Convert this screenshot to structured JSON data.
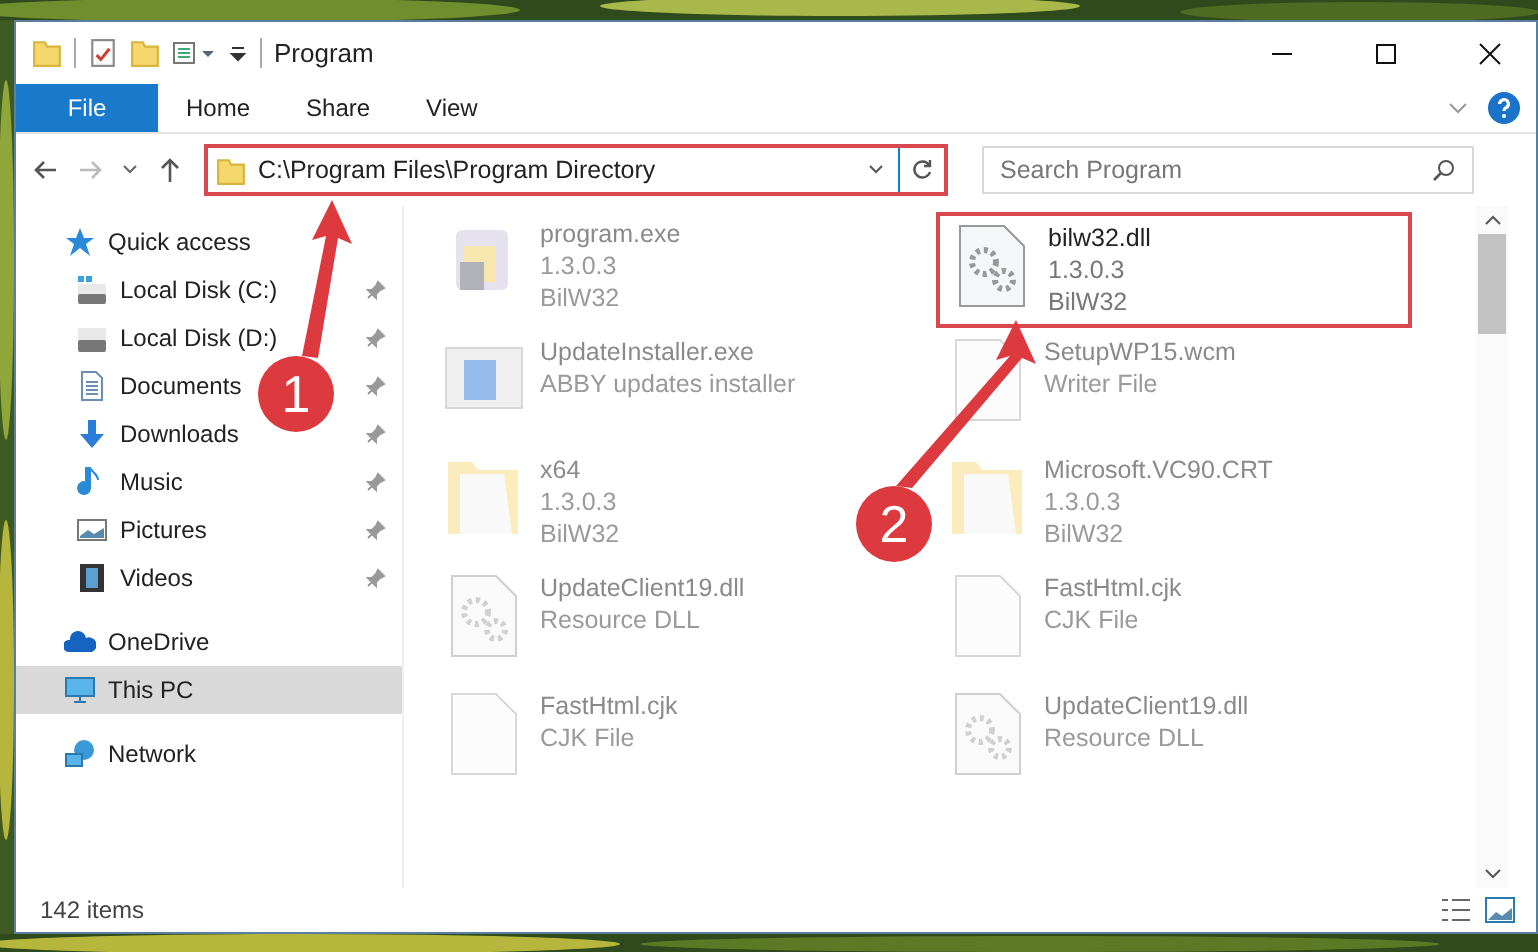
{
  "window": {
    "title": "Program"
  },
  "ribbon": {
    "tabs": [
      {
        "label": "File",
        "kind": "file",
        "selected": false
      },
      {
        "label": "Home",
        "kind": "tab",
        "selected": false
      },
      {
        "label": "Share",
        "kind": "tab",
        "selected": false
      },
      {
        "label": "View",
        "kind": "tab",
        "selected": false
      }
    ]
  },
  "address": {
    "path": "C:\\Program Files\\Program Directory",
    "highlighted": true
  },
  "search": {
    "placeholder": "Search Program"
  },
  "sidebar": {
    "items": [
      {
        "label": "Quick access",
        "kind": "star",
        "pinned": false,
        "selected": false,
        "children": [
          {
            "label": "Local Disk (C:)",
            "kind": "osdisk",
            "pinned": true,
            "selected": false
          },
          {
            "label": "Local Disk (D:)",
            "kind": "disk",
            "pinned": true,
            "selected": false
          },
          {
            "label": "Documents",
            "kind": "documents",
            "pinned": true,
            "selected": false
          },
          {
            "label": "Downloads",
            "kind": "downloads",
            "pinned": true,
            "selected": false
          },
          {
            "label": "Music",
            "kind": "music",
            "pinned": true,
            "selected": false
          },
          {
            "label": "Pictures",
            "kind": "pictures",
            "pinned": true,
            "selected": false
          },
          {
            "label": "Videos",
            "kind": "videos",
            "pinned": true,
            "selected": false
          }
        ]
      },
      {
        "label": "OneDrive",
        "kind": "cloud",
        "pinned": false,
        "selected": false
      },
      {
        "label": "This PC",
        "kind": "pc",
        "pinned": false,
        "selected": true
      },
      {
        "label": "Network",
        "kind": "network",
        "pinned": false,
        "selected": false
      }
    ]
  },
  "files": [
    {
      "name": "program.exe",
      "details": [
        "1.3.0.3",
        "BilW32"
      ],
      "kind": "app",
      "faded": true,
      "highlighted": false
    },
    {
      "name": "bilw32.dll",
      "details": [
        "1.3.0.3",
        "BilW32"
      ],
      "kind": "gear",
      "faded": false,
      "highlighted": true
    },
    {
      "name": "UpdateInstaller.exe",
      "details": [
        "ABBY updates installer"
      ],
      "kind": "installer",
      "faded": true,
      "highlighted": false
    },
    {
      "name": "SetupWP15.wcm",
      "details": [
        "Writer File"
      ],
      "kind": "blank",
      "faded": true,
      "highlighted": false
    },
    {
      "name": "x64",
      "details": [
        "1.3.0.3",
        "BilW32"
      ],
      "kind": "folder",
      "faded": true,
      "highlighted": false
    },
    {
      "name": "Microsoft.VC90.CRT",
      "details": [
        "1.3.0.3",
        "BilW32"
      ],
      "kind": "folder",
      "faded": true,
      "highlighted": false
    },
    {
      "name": "UpdateClient19.dll",
      "details": [
        "Resource DLL"
      ],
      "kind": "gear",
      "faded": true,
      "highlighted": false
    },
    {
      "name": "FastHtml.cjk",
      "details": [
        "CJK File"
      ],
      "kind": "blank",
      "faded": true,
      "highlighted": false
    },
    {
      "name": "FastHtml.cjk",
      "details": [
        "CJK File"
      ],
      "kind": "blank",
      "faded": true,
      "highlighted": false
    },
    {
      "name": "UpdateClient19.dll",
      "details": [
        "Resource DLL"
      ],
      "kind": "gear",
      "faded": true,
      "highlighted": false
    }
  ],
  "callouts": [
    {
      "number": "1"
    },
    {
      "number": "2"
    }
  ],
  "status_bar": {
    "count": "142 items"
  }
}
